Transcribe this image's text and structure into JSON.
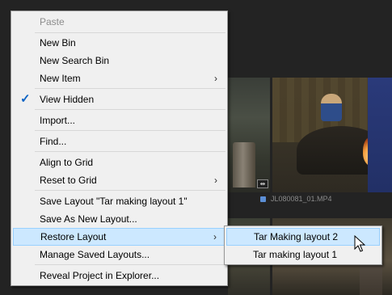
{
  "background": {
    "clip_name": "JL080081_01.MP4",
    "badge_icon": "multicam-badge-icon"
  },
  "menu": {
    "items": [
      {
        "label": "Paste",
        "disabled": true
      },
      {
        "label": "New Bin"
      },
      {
        "label": "New Search Bin"
      },
      {
        "label": "New Item",
        "submenu": true
      },
      {
        "label": "View Hidden",
        "checked": true
      },
      {
        "label": "Import..."
      },
      {
        "label": "Find..."
      },
      {
        "label": "Align to Grid"
      },
      {
        "label": "Reset to Grid",
        "submenu": true
      },
      {
        "label": "Save Layout \"Tar making layout 1\""
      },
      {
        "label": "Save As New Layout..."
      },
      {
        "label": "Restore Layout",
        "submenu": true,
        "highlighted": true
      },
      {
        "label": "Manage Saved Layouts..."
      },
      {
        "label": "Reveal Project in Explorer..."
      }
    ],
    "submenu_arrow": "›",
    "check_mark": "✓"
  },
  "submenu": {
    "items": [
      {
        "label": "Tar Making layout 2",
        "highlighted": true
      },
      {
        "label": "Tar making layout 1"
      }
    ]
  },
  "colors": {
    "menu_bg": "#f0f0f0",
    "highlight_bg": "#cce8ff",
    "highlight_border": "#99d1ff",
    "check": "#0b63c4"
  }
}
